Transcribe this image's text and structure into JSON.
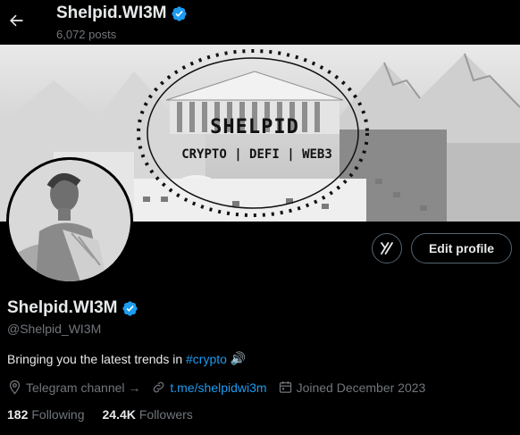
{
  "header": {
    "back_icon": "arrow-left-icon",
    "title": "Shelpid.WI3M",
    "posts_count": "6,072 posts"
  },
  "banner": {
    "brand": "SHELPID",
    "tagline": "CRYPTO | DEFI | WEB3"
  },
  "actions": {
    "grok_icon": "grok-icon",
    "edit_label": "Edit profile"
  },
  "profile": {
    "name": "Shelpid.WI3M",
    "verified_icon": "verified-badge-icon",
    "handle": "@Shelpid_WI3M",
    "bio_prefix": "Bringing you the latest trends in ",
    "bio_hashtag": "#crypto",
    "bio_suffix": " 🔊",
    "location": "Telegram channel →",
    "website": "t.me/shelpidwi3m",
    "joined": "Joined December 2023"
  },
  "stats": {
    "following_count": "182",
    "following_label": "Following",
    "followers_count": "24.4K",
    "followers_label": "Followers"
  },
  "colors": {
    "background": "#000000",
    "text_primary": "#e7e9ea",
    "text_secondary": "#71767b",
    "accent": "#1d9bf0",
    "border": "#536471"
  }
}
